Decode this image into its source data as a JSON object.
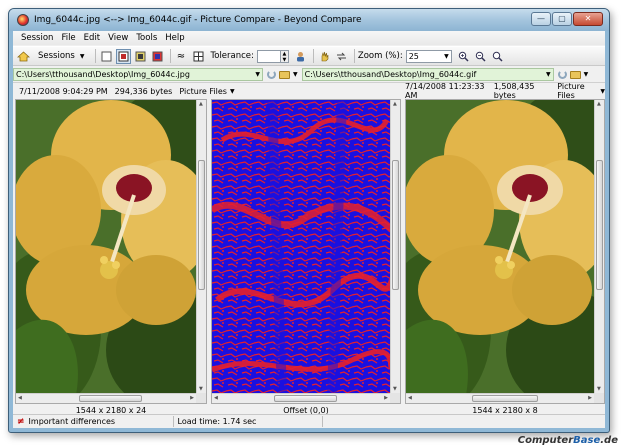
{
  "window": {
    "title": "Img_6044c.jpg <--> Img_6044c.gif - Picture Compare - Beyond Compare",
    "controls": {
      "minimize": "—",
      "maximize": "▢",
      "close": "✕"
    }
  },
  "menu": [
    "Session",
    "File",
    "Edit",
    "View",
    "Tools",
    "Help"
  ],
  "toolbar": {
    "sessions_label": "Sessions",
    "tolerance_label": "Tolerance:",
    "tolerance_value": "",
    "zoom_label": "Zoom (%):",
    "zoom_value": "25"
  },
  "left": {
    "path": "C:\\Users\\tthousand\\Desktop\\Img_6044c.jpg",
    "datetime": "7/11/2008 9:04:29 PM",
    "size": "294,336 bytes",
    "filter": "Picture Files",
    "dimensions": "1544 x 2180 x 24"
  },
  "right": {
    "path": "C:\\Users\\tthousand\\Desktop\\Img_6044c.gif",
    "datetime": "7/14/2008 11:23:33 AM",
    "size": "1,508,435 bytes",
    "filter": "Picture Files",
    "dimensions": "1544 x 2180 x 8"
  },
  "center": {
    "offset": "Offset (0,0)"
  },
  "status": {
    "mode": "Important differences",
    "load_time": "Load time: 1.74 sec"
  },
  "watermark": {
    "part1": "Computer",
    "part2": "Base",
    "part3": ".de"
  },
  "colors": {
    "diff_red": "#e8202a",
    "diff_blue": "#1a10e0",
    "petal": "#e2b54a",
    "leaf": "#3f6d1f"
  }
}
